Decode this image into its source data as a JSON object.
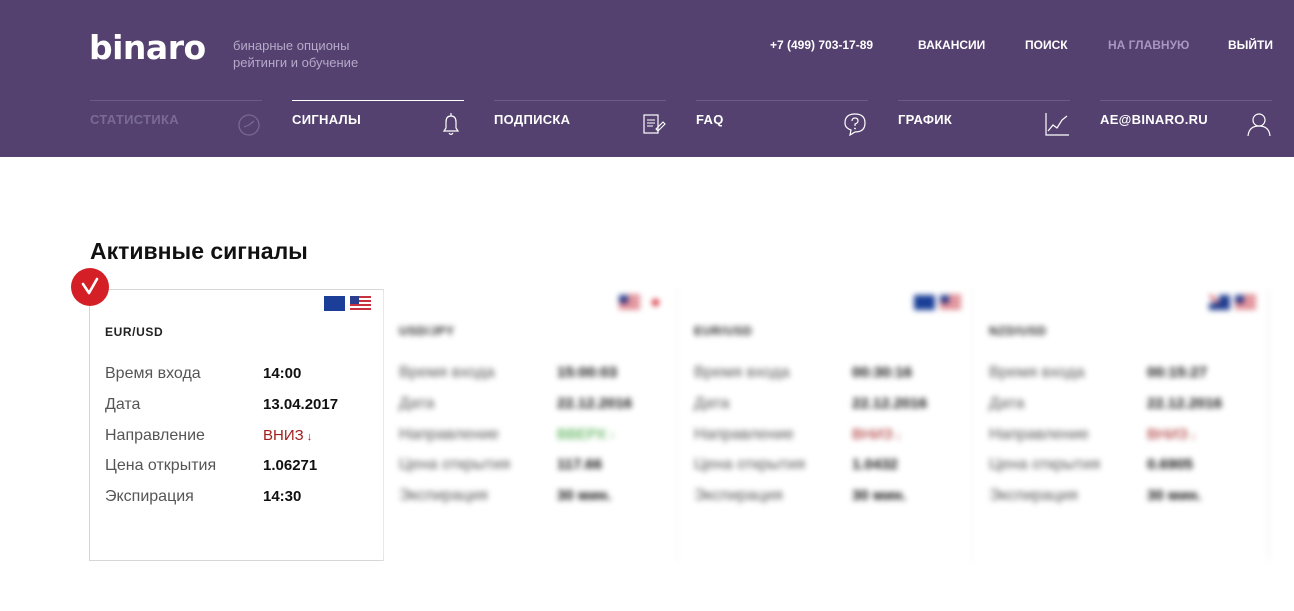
{
  "header": {
    "logo": "binaro",
    "tagline_line1": "бинарные опционы",
    "tagline_line2": "рейтинги и обучение",
    "phone": "+7 (499) 703-17-89",
    "links": {
      "vacancies": "ВАКАНСИИ",
      "search": "ПОИСК",
      "home": "НА ГЛАВНУЮ",
      "logout": "ВЫЙТИ"
    }
  },
  "nav": {
    "items": [
      {
        "label": "СТАТИСТИКА",
        "icon": "stopwatch-icon"
      },
      {
        "label": "СИГНАЛЫ",
        "icon": "bell-icon"
      },
      {
        "label": "ПОДПИСКА",
        "icon": "document-icon"
      },
      {
        "label": "FAQ",
        "icon": "question-bubble-icon"
      },
      {
        "label": "ГРАФИК",
        "icon": "chart-icon"
      },
      {
        "label": "AE@BINARO.RU",
        "icon": "user-icon"
      }
    ]
  },
  "main": {
    "title": "Активные сигналы",
    "labels": {
      "entry_time": "Время входа",
      "date": "Дата",
      "direction": "Направление",
      "open_price": "Цена открытия",
      "expiration": "Экспирация"
    },
    "signals": [
      {
        "pair": "EUR/USD",
        "flags": [
          "eu",
          "us"
        ],
        "entry_time": "14:00",
        "date": "13.04.2017",
        "direction": "ВНИЗ",
        "direction_arrow": "↓",
        "open_price": "1.06271",
        "expiration": "14:30"
      },
      {
        "pair": "USD/JPY",
        "flags": [
          "us",
          "jp"
        ],
        "entry_time": "15:00:03",
        "date": "22.12.2016",
        "direction": "ВВЕРХ",
        "direction_arrow": "↑",
        "open_price": "117.66",
        "expiration": "30 мин."
      },
      {
        "pair": "EUR/USD",
        "flags": [
          "eu",
          "us"
        ],
        "entry_time": "00:30:16",
        "date": "22.12.2016",
        "direction": "ВНИЗ",
        "direction_arrow": "↓",
        "open_price": "1.0432",
        "expiration": "30 мин."
      },
      {
        "pair": "NZD/USD",
        "flags": [
          "nz",
          "us"
        ],
        "entry_time": "00:15:27",
        "date": "22.12.2016",
        "direction": "ВНИЗ",
        "direction_arrow": "↓",
        "open_price": "0.6905",
        "expiration": "30 мин."
      }
    ]
  },
  "colors": {
    "header_bg": "#54416f",
    "accent_red": "#d41f26",
    "down": "#a11d1d",
    "up": "#3aa33a"
  }
}
